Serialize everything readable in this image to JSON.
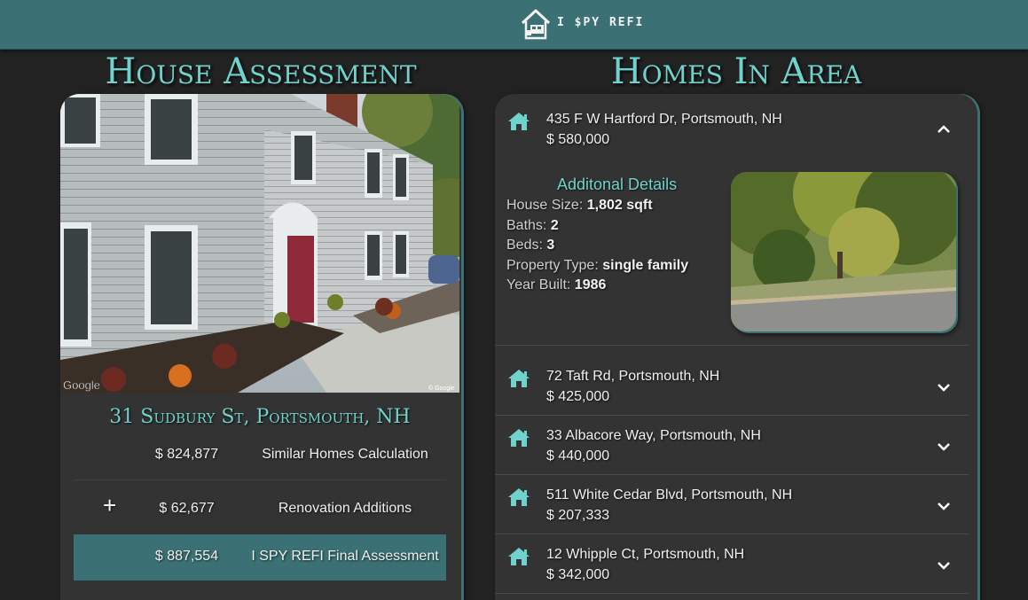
{
  "header": {
    "brand": "I $PY REFI",
    "logo_icon": "house-with-cart-icon",
    "background_color": "#3b7174"
  },
  "assessment": {
    "title": "House Assessment",
    "photo_attribution_left": "Google",
    "photo_attribution_right": "© Google",
    "address": "31 Sudbury St, Portsmouth, NH",
    "rows": [
      {
        "symbol": "",
        "amount": "$ 824,877",
        "label": "Similar Homes Calculation"
      },
      {
        "symbol": "+",
        "amount": "$ 62,677",
        "label": "Renovation Additions"
      },
      {
        "symbol": "",
        "amount": "$ 887,554",
        "label": "I SPY REFI Final Assessment"
      }
    ]
  },
  "homes": {
    "title": "Homes In Area",
    "accent_color": "#6fd2cc",
    "expanded": {
      "address": "435 F W Hartford Dr, Portsmouth, NH",
      "price": "$ 580,000",
      "details_title": "Additonal Details",
      "details": [
        {
          "label": "House Size:",
          "value": "1,802 sqft"
        },
        {
          "label": "Baths:",
          "value": "2"
        },
        {
          "label": "Beds:",
          "value": "3"
        },
        {
          "label": "Property Type:",
          "value": "single family"
        },
        {
          "label": "Year Built:",
          "value": "1986"
        }
      ]
    },
    "items": [
      {
        "address": "72 Taft Rd, Portsmouth, NH",
        "price": "$ 425,000"
      },
      {
        "address": "33 Albacore Way, Portsmouth, NH",
        "price": "$ 440,000"
      },
      {
        "address": "511 White Cedar Blvd, Portsmouth, NH",
        "price": "$ 207,333"
      },
      {
        "address": "12 Whipple Ct, Portsmouth, NH",
        "price": "$ 342,000"
      }
    ]
  }
}
